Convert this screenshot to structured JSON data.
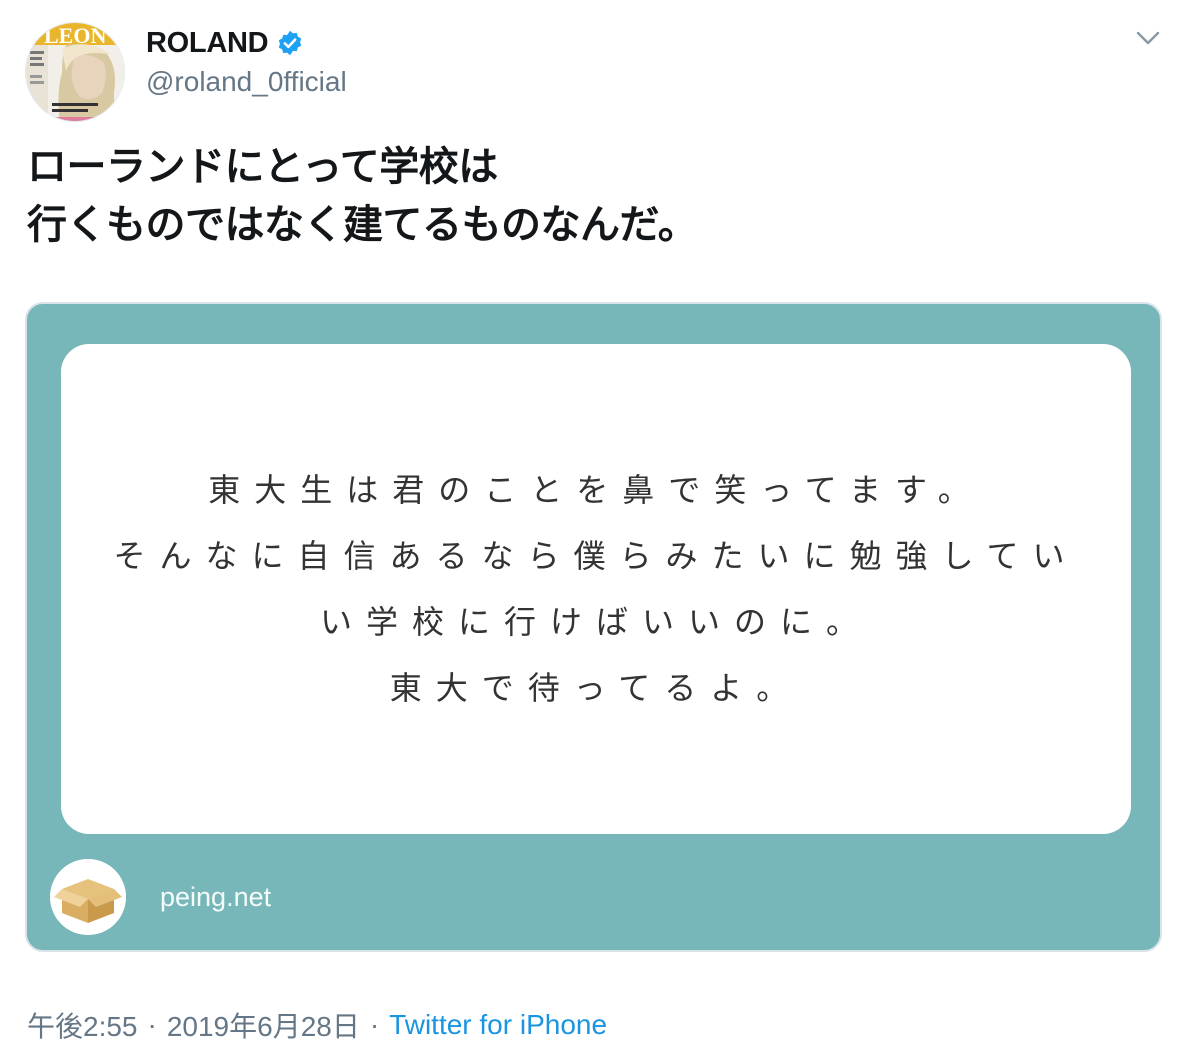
{
  "author": {
    "display_name": "ROLAND",
    "handle": "@roland_0fficial",
    "verified": true,
    "avatar_icon": "magazine-cover-avatar"
  },
  "tweet": {
    "text": "ローランドにとって学校は\n行くものではなく建てるものなんだ。"
  },
  "media": {
    "background_color": "#78b7b9",
    "question_lines": [
      "東大生は君のことを鼻で笑ってます。",
      "そんなに自信あるなら僕らみたいに勉強してい",
      "い学校に行けばいいのに。",
      "東大で待ってるよ。"
    ],
    "source_label": "peing.net",
    "source_icon": "cardboard-box-icon"
  },
  "meta": {
    "time": "午後2:55",
    "separator": "·",
    "date": "2019年6月28日",
    "source": "Twitter for iPhone"
  },
  "colors": {
    "link": "#1b95e0",
    "verified": "#1da1f2",
    "secondary_text": "#657786"
  }
}
